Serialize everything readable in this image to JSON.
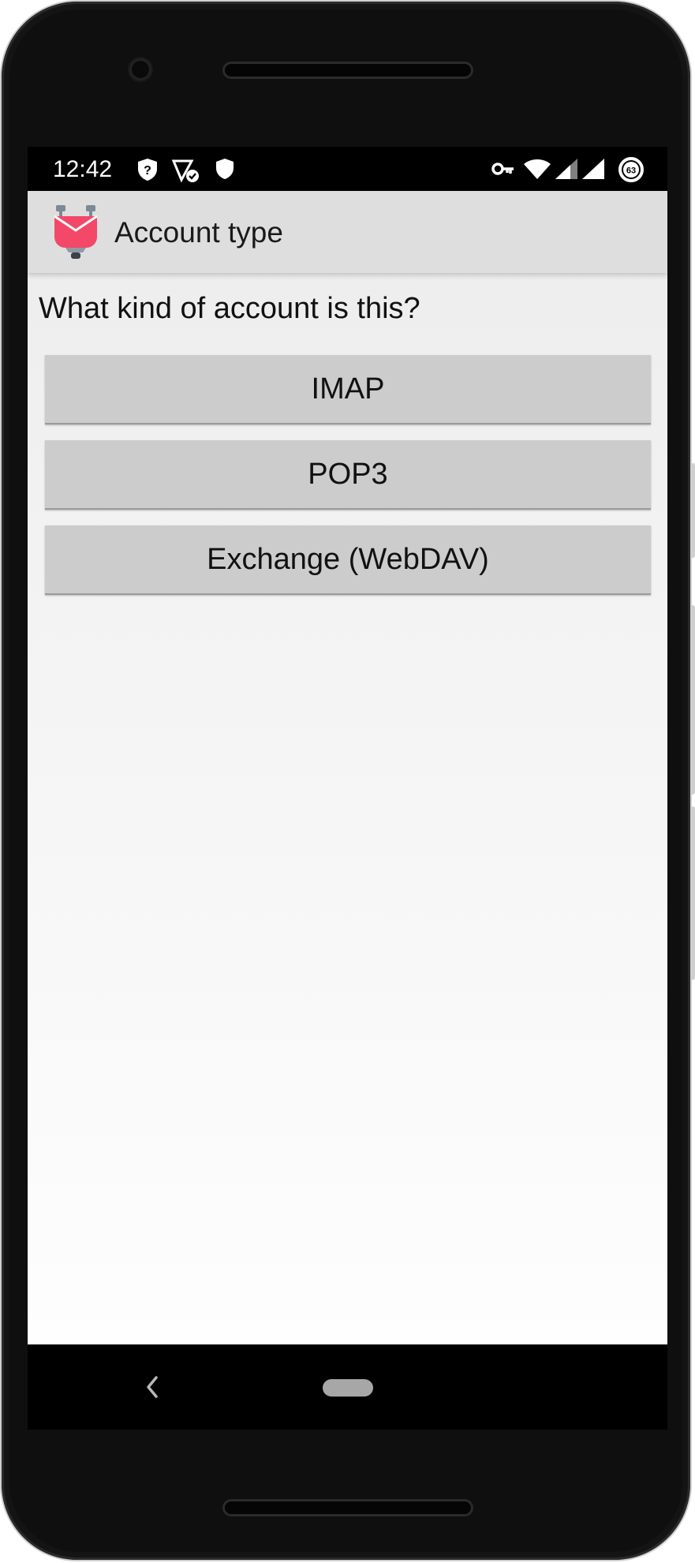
{
  "status_bar": {
    "time": "12:42",
    "battery_level": "63",
    "left_icons": [
      "unknown-shield-icon",
      "network-check-icon",
      "shield-icon"
    ],
    "right_icons": [
      "vpn-key-icon",
      "wifi-icon",
      "signal-icon",
      "signal-icon",
      "battery-saver-icon"
    ]
  },
  "app_bar": {
    "title": "Account type",
    "logo_icon": "k9-mail-logo-icon",
    "logo_color": "#f44868"
  },
  "content": {
    "prompt": "What kind of account is this?",
    "options": [
      {
        "label": "IMAP"
      },
      {
        "label": "POP3"
      },
      {
        "label": "Exchange (WebDAV)"
      }
    ]
  },
  "nav_bar": {
    "back_icon": "chevron-left-icon",
    "home_icon": "home-pill-icon"
  }
}
